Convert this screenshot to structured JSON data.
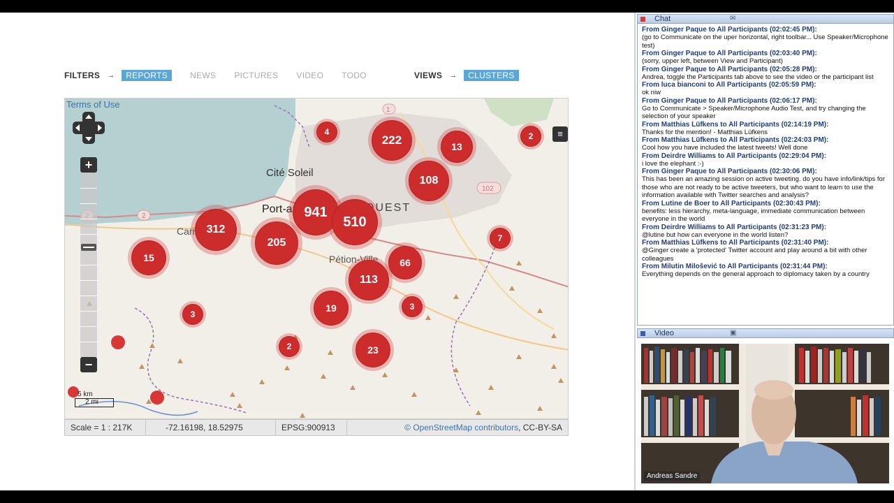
{
  "filters": {
    "label": "FILTERS",
    "arrow": "→",
    "tabs": [
      {
        "label": "REPORTS",
        "active": true
      },
      {
        "label": "NEWS",
        "active": false
      },
      {
        "label": "PICTURES",
        "active": false
      },
      {
        "label": "VIDEO",
        "active": false
      },
      {
        "label": "TODO",
        "active": false
      }
    ]
  },
  "views": {
    "label": "VIEWS",
    "arrow": "→",
    "active_tab": "CLUSTERS"
  },
  "map": {
    "terms_link": "Terms of Use",
    "zoom_in": "+",
    "zoom_out": "−",
    "zoom_level_fraction": 0.38,
    "places": [
      "Cité Soleil",
      "Port-au-",
      "OUEST",
      "Carrefour",
      "Pétion-Ville"
    ],
    "road_labels": [
      "1",
      "2",
      "2",
      "102"
    ],
    "clusters": [
      "222",
      "13",
      "108",
      "941",
      "510",
      "312",
      "205",
      "15",
      "66",
      "113",
      "19",
      "3",
      "3",
      "23",
      "2",
      "4",
      "2",
      "7"
    ],
    "scale_km": "5 km",
    "scale_mi": "2 mi",
    "colors": {
      "cluster": "#cc2c2c",
      "water": "#b5d0d0",
      "land": "#f1efe8"
    }
  },
  "status": {
    "scale": "Scale = 1 : 217K",
    "coords": "-72.16198, 18.52975",
    "epsg": "EPSG:900913",
    "copyright": "©",
    "osm_link": "OpenStreetMap contributors",
    "license": ", CC-BY-SA"
  },
  "chat": {
    "title": "Chat",
    "messages": [
      {
        "from": "From Ginger Paque to All Participants (02:02:45 PM):",
        "text": "(go to Communicate on the uper horizontal, right toolbar...  Use Speaker/Microphone test)"
      },
      {
        "from": "From Ginger Paque to All Participants (02:03:40 PM):",
        "text": "(sorry, upper left, between View and Participant)"
      },
      {
        "from": "From Ginger Paque to All Participants (02:05:28 PM):",
        "text": "Andrea, toggle the Participants tab above to see the video or the participant list"
      },
      {
        "from": "From luca bianconi to All Participants (02:05:59 PM):",
        "text": "ok niw"
      },
      {
        "from": "From Ginger Paque to All Participants (02:06:17 PM):",
        "text": "Go to Communicate > Speaker/Microphone Audio Test, and try changing the selection of your speaker"
      },
      {
        "from": "From Matthias Lüfkens to All Participants (02:14:19 PM):",
        "text": "Thanks for the mention! - Matthias Lüfkens"
      },
      {
        "from": "From Matthias Lüfkens to All Participants (02:24:03 PM):",
        "text": "Cool how you have included the latest tweets! Well done"
      },
      {
        "from": "From Deirdre Williams to All Participants (02:29:04 PM):",
        "text": "i love the elephant :-)"
      },
      {
        "from": "From Ginger Paque to All Participants (02:30:06 PM):",
        "text": "This has been an amazing session on active tweeting. do you have info/link/tips for those who are not ready to be active tweeters, but who want to learn to use the information available with Twitter searches and analysis?"
      },
      {
        "from": "From Lutine de Boer to All Participants (02:30:43 PM):",
        "text": "benefits: less hierarchy, meta-language, immediate communication between everyone in the world"
      },
      {
        "from": "From Deirdre Williams to All Participants (02:31:23 PM):",
        "text": "@lutine but how can everyone in the world listen?"
      },
      {
        "from": "From Matthias Lüfkens to All Participants (02:31:40 PM):",
        "text": "@Ginger create a 'protected' Twitter account and play around a bit with other colleagues"
      },
      {
        "from": "From Milutin Milošević to All Participants (02:31:44 PM):",
        "text": "Everything depends on the general approach to diplomacy taken by a country"
      }
    ]
  },
  "video": {
    "title": "Video",
    "participant_name": "Andreas Sandre"
  }
}
